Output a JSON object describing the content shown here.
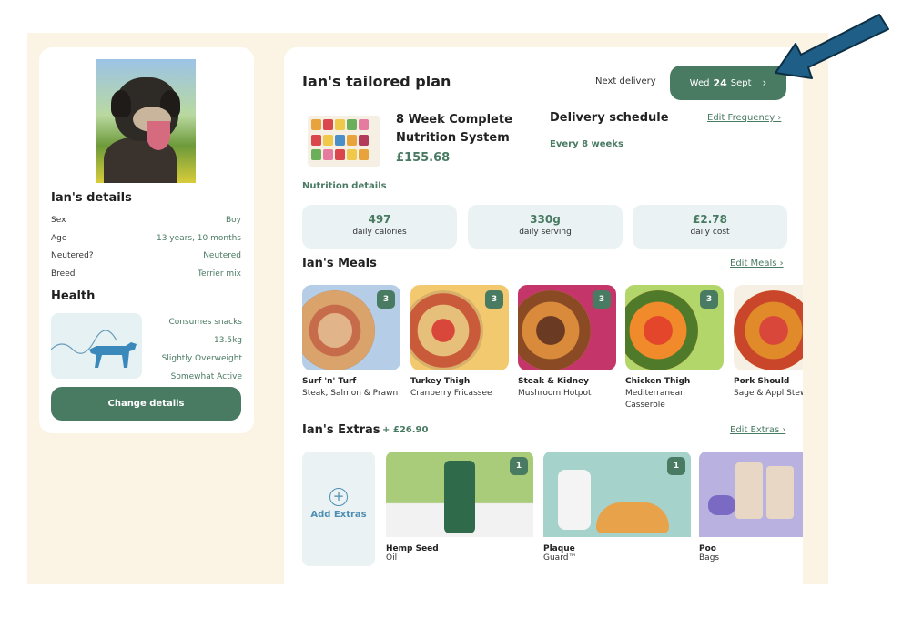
{
  "dog": {
    "details_title": "Ian's details",
    "details": [
      {
        "label": "Sex",
        "value": "Boy"
      },
      {
        "label": "Age",
        "value": "13 years, 10 months"
      },
      {
        "label": "Neutered?",
        "value": "Neutered"
      },
      {
        "label": "Breed",
        "value": "Terrier mix"
      }
    ],
    "health_title": "Health",
    "health": [
      "Consumes snacks",
      "13.5kg",
      "Slightly Overweight",
      "Somewhat Active"
    ],
    "change_button": "Change details"
  },
  "plan": {
    "title": "Ian's tailored plan",
    "next_delivery_label": "Next delivery",
    "delivery_day": "Wed",
    "delivery_date": "24",
    "delivery_month": "Sept",
    "product_name": "8 Week Complete Nutrition System",
    "product_price": "£155.68",
    "schedule_title": "Delivery schedule",
    "schedule_value": "Every 8 weeks",
    "edit_frequency": "Edit Frequency ›",
    "nutrition_label": "Nutrition details",
    "stats": [
      {
        "value": "497",
        "label": "daily calories"
      },
      {
        "value": "330g",
        "label": "daily serving"
      },
      {
        "value": "£2.78",
        "label": "daily cost"
      }
    ]
  },
  "meals": {
    "title": "Ian's Meals",
    "edit_link": "Edit Meals ›",
    "items": [
      {
        "name": "Surf 'n' Turf",
        "desc": "Steak, Salmon & Prawn",
        "qty": "3",
        "bg": "#b5cde6"
      },
      {
        "name": "Turkey Thigh",
        "desc": "Cranberry Fricassee",
        "qty": "3",
        "bg": "#f2c96e"
      },
      {
        "name": "Steak & Kidney",
        "desc": "Mushroom Hotpot",
        "qty": "3",
        "bg": "#c4366a"
      },
      {
        "name": "Chicken Thigh",
        "desc": "Mediterranean Casserole",
        "qty": "3",
        "bg": "#b3d66a"
      },
      {
        "name": "Pork Should",
        "desc": "Sage & Appl Stew",
        "qty": "",
        "bg": "#f6efe4"
      }
    ]
  },
  "extras": {
    "title": "Ian's Extras",
    "price": "+ £26.90",
    "edit_link": "Edit Extras ›",
    "add_label": "Add Extras",
    "items": [
      {
        "name": "Hemp Seed",
        "desc": "Oil",
        "qty": "1",
        "bg": "#a8cc7a"
      },
      {
        "name": "Plaque",
        "desc": "Guard™",
        "qty": "1",
        "bg": "#a6d2cc"
      },
      {
        "name": "Poo",
        "desc": "Bags",
        "qty": "",
        "bg": "#b9b2e0"
      }
    ]
  },
  "colors": {
    "brand": "#497a62",
    "accent_blue": "#4f8fb3",
    "background": "#fbf4e4",
    "arrow": "#1f5f87"
  }
}
